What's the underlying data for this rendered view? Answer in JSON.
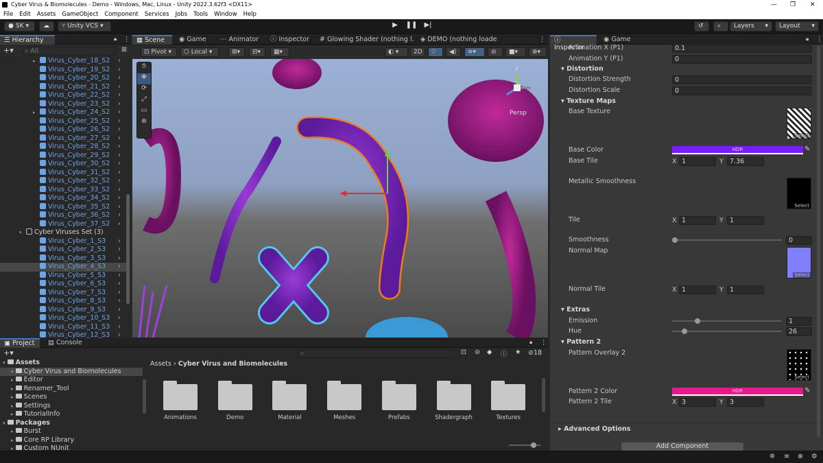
{
  "window": {
    "title": "Cyber Virus & Biomolecules - Demo - Windows, Mac, Linux - Unity 2022.3.62f3 <DX11>"
  },
  "menu": [
    "File",
    "Edit",
    "Assets",
    "GameObject",
    "Component",
    "Services",
    "Jobs",
    "Tools",
    "Window",
    "Help"
  ],
  "toolbar": {
    "account": "SK",
    "vcs": "Unity VCS",
    "layers": "Layers",
    "layout": "Layout"
  },
  "hierarchy": {
    "tab": "Hierarchy",
    "search_placeholder": "All",
    "rows": [
      "Virus_Cyber_18_S2",
      "Virus_Cyber_19_S2",
      "Virus_Cyber_20_S2",
      "Virus_Cyber_21_S2",
      "Virus_Cyber_22_S2",
      "Virus_Cyber_23_S2",
      "Virus_Cyber_24_S2",
      "Virus_Cyber_25_S2",
      "Virus_Cyber_26_S2",
      "Virus_Cyber_27_S2",
      "Virus_Cyber_28_S2",
      "Virus_Cyber_29_S2",
      "Virus_Cyber_30_S2",
      "Virus_Cyber_31_S2",
      "Virus_Cyber_32_S2",
      "Virus_Cyber_33_S2",
      "Virus_Cyber_34_S2",
      "Virus_Cyber_35_S2",
      "Virus_Cyber_36_S2",
      "Virus_Cyber_37_S2",
      "Cyber Viruses Set (3)",
      "Virus_Cyber_1_S3",
      "Virus_Cyber_2_S3",
      "Virus_Cyber_3_S3",
      "Virus_Cyber_4_S3",
      "Virus_Cyber_5_S3",
      "Virus_Cyber_6_S3",
      "Virus_Cyber_7_S3",
      "Virus_Cyber_8_S3",
      "Virus_Cyber_9_S3",
      "Virus_Cyber_10_S3",
      "Virus_Cyber_11_S3",
      "Virus_Cyber_12_S3"
    ]
  },
  "scene": {
    "tabs": [
      "Scene",
      "Game",
      "Animator",
      "Inspector",
      "Glowing Shader (nothing l...",
      "DEMO (nothing loaded)"
    ],
    "pivot": "Pivot",
    "local": "Local",
    "mode_2d": "2D",
    "persp": "Persp",
    "gizmo_y": "y"
  },
  "inspector": {
    "tabs": [
      "Inspector",
      "Game"
    ],
    "anim_x_label": "Animation X (P1)",
    "anim_x": "0.1",
    "anim_y_label": "Animation Y (P1)",
    "anim_y": "0",
    "distortion": "Distortion",
    "dist_strength_label": "Distortion Strength",
    "dist_strength": "0",
    "dist_scale_label": "Distortion Scale",
    "dist_scale": "0",
    "texture_maps": "Texture Maps",
    "base_texture": "Base Texture",
    "base_color_label": "Base Color",
    "hdr": "HDR",
    "base_tile_label": "Base Tile",
    "base_tile_x": "1",
    "base_tile_y": "7.36",
    "metallic": "Metallic Smoothness",
    "tile_label": "Tile",
    "tile_x": "1",
    "tile_y": "1",
    "smoothness_label": "Smoothness",
    "smoothness": "0",
    "normal_map": "Normal Map",
    "normal_tile_label": "Normal Tile",
    "normal_tile_x": "1",
    "normal_tile_y": "1",
    "extras": "Extras",
    "emission_label": "Emission",
    "emission": "1",
    "hue_label": "Hue",
    "hue": "26",
    "pattern2": "Pattern 2",
    "pattern_overlay": "Pattern Overlay 2",
    "pattern_color_label": "Pattern 2 Color",
    "pattern_tile_label": "Pattern 2 Tile",
    "pattern_tile_x": "3",
    "pattern_tile_y": "3",
    "advanced": "Advanced Options",
    "add_component": "Add Component",
    "select": "Select",
    "x": "X",
    "y": "Y",
    "smoothness_level": 0.0,
    "emission_level": 0.22,
    "hue_level": 0.09,
    "colors": {
      "base": "#7a1cff",
      "pattern": "#e6198c",
      "normal": "#8080ff"
    }
  },
  "project": {
    "tabs": [
      "Project",
      "Console"
    ],
    "tree": [
      {
        "label": "Assets",
        "bold": true
      },
      {
        "label": "Cyber Virus and Biomolecules"
      },
      {
        "label": "Editor"
      },
      {
        "label": "Renamer_Tool"
      },
      {
        "label": "Scenes"
      },
      {
        "label": "Settings"
      },
      {
        "label": "TutorialInfo"
      },
      {
        "label": "Packages",
        "bold": true
      },
      {
        "label": "Burst"
      },
      {
        "label": "Core RP Library"
      },
      {
        "label": "Custom NUnit"
      }
    ],
    "breadcrumb_root": "Assets",
    "breadcrumb_leaf": "Cyber Virus and Biomolecules",
    "count": "18",
    "folders": [
      "Animations",
      "Demo",
      "Material",
      "Meshes",
      "Prefabs",
      "Shadergraph",
      "Textures"
    ]
  }
}
